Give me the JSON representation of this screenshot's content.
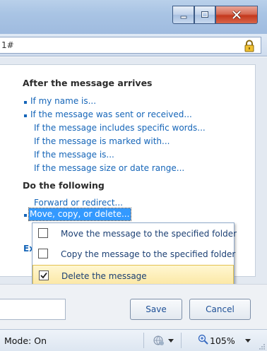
{
  "address": {
    "text": "1#"
  },
  "rules": {
    "arrives_heading": "After the message arrives",
    "conditions": [
      {
        "label": "If my name is...",
        "bulleted": true
      },
      {
        "label": "If the message was sent or received...",
        "bulleted": true
      },
      {
        "label": "If the message includes specific words...",
        "bulleted": false
      },
      {
        "label": "If the message is marked with...",
        "bulleted": false
      },
      {
        "label": "If the message is...",
        "bulleted": false
      },
      {
        "label": "If the message size or date range...",
        "bulleted": false
      }
    ],
    "actions_heading": "Do the following",
    "actions": [
      {
        "label": "Forward or redirect...",
        "bulleted": false
      },
      {
        "label": "Move, copy, or delete...",
        "bulleted": true,
        "selected": true
      }
    ],
    "exceptions_label_partial": "Ex"
  },
  "menu": {
    "items": [
      {
        "label": "Move the message to the specified folder",
        "checked": false
      },
      {
        "label": "Copy the message to the specified folder",
        "checked": false
      },
      {
        "label": "Delete the message",
        "checked": true
      }
    ]
  },
  "buttons": {
    "save": "Save",
    "cancel": "Cancel"
  },
  "status": {
    "mode": "Mode: On",
    "zoom": "105%"
  },
  "colors": {
    "link": "#1565b8",
    "selection": "#3399ff",
    "menu_highlight": "#fbe7a3"
  },
  "icons": [
    "minimize-icon",
    "maximize-icon",
    "close-icon",
    "lock-icon",
    "check-icon",
    "globe-icon",
    "zoom-icon",
    "chevron-down-icon",
    "resize-grip-icon"
  ]
}
